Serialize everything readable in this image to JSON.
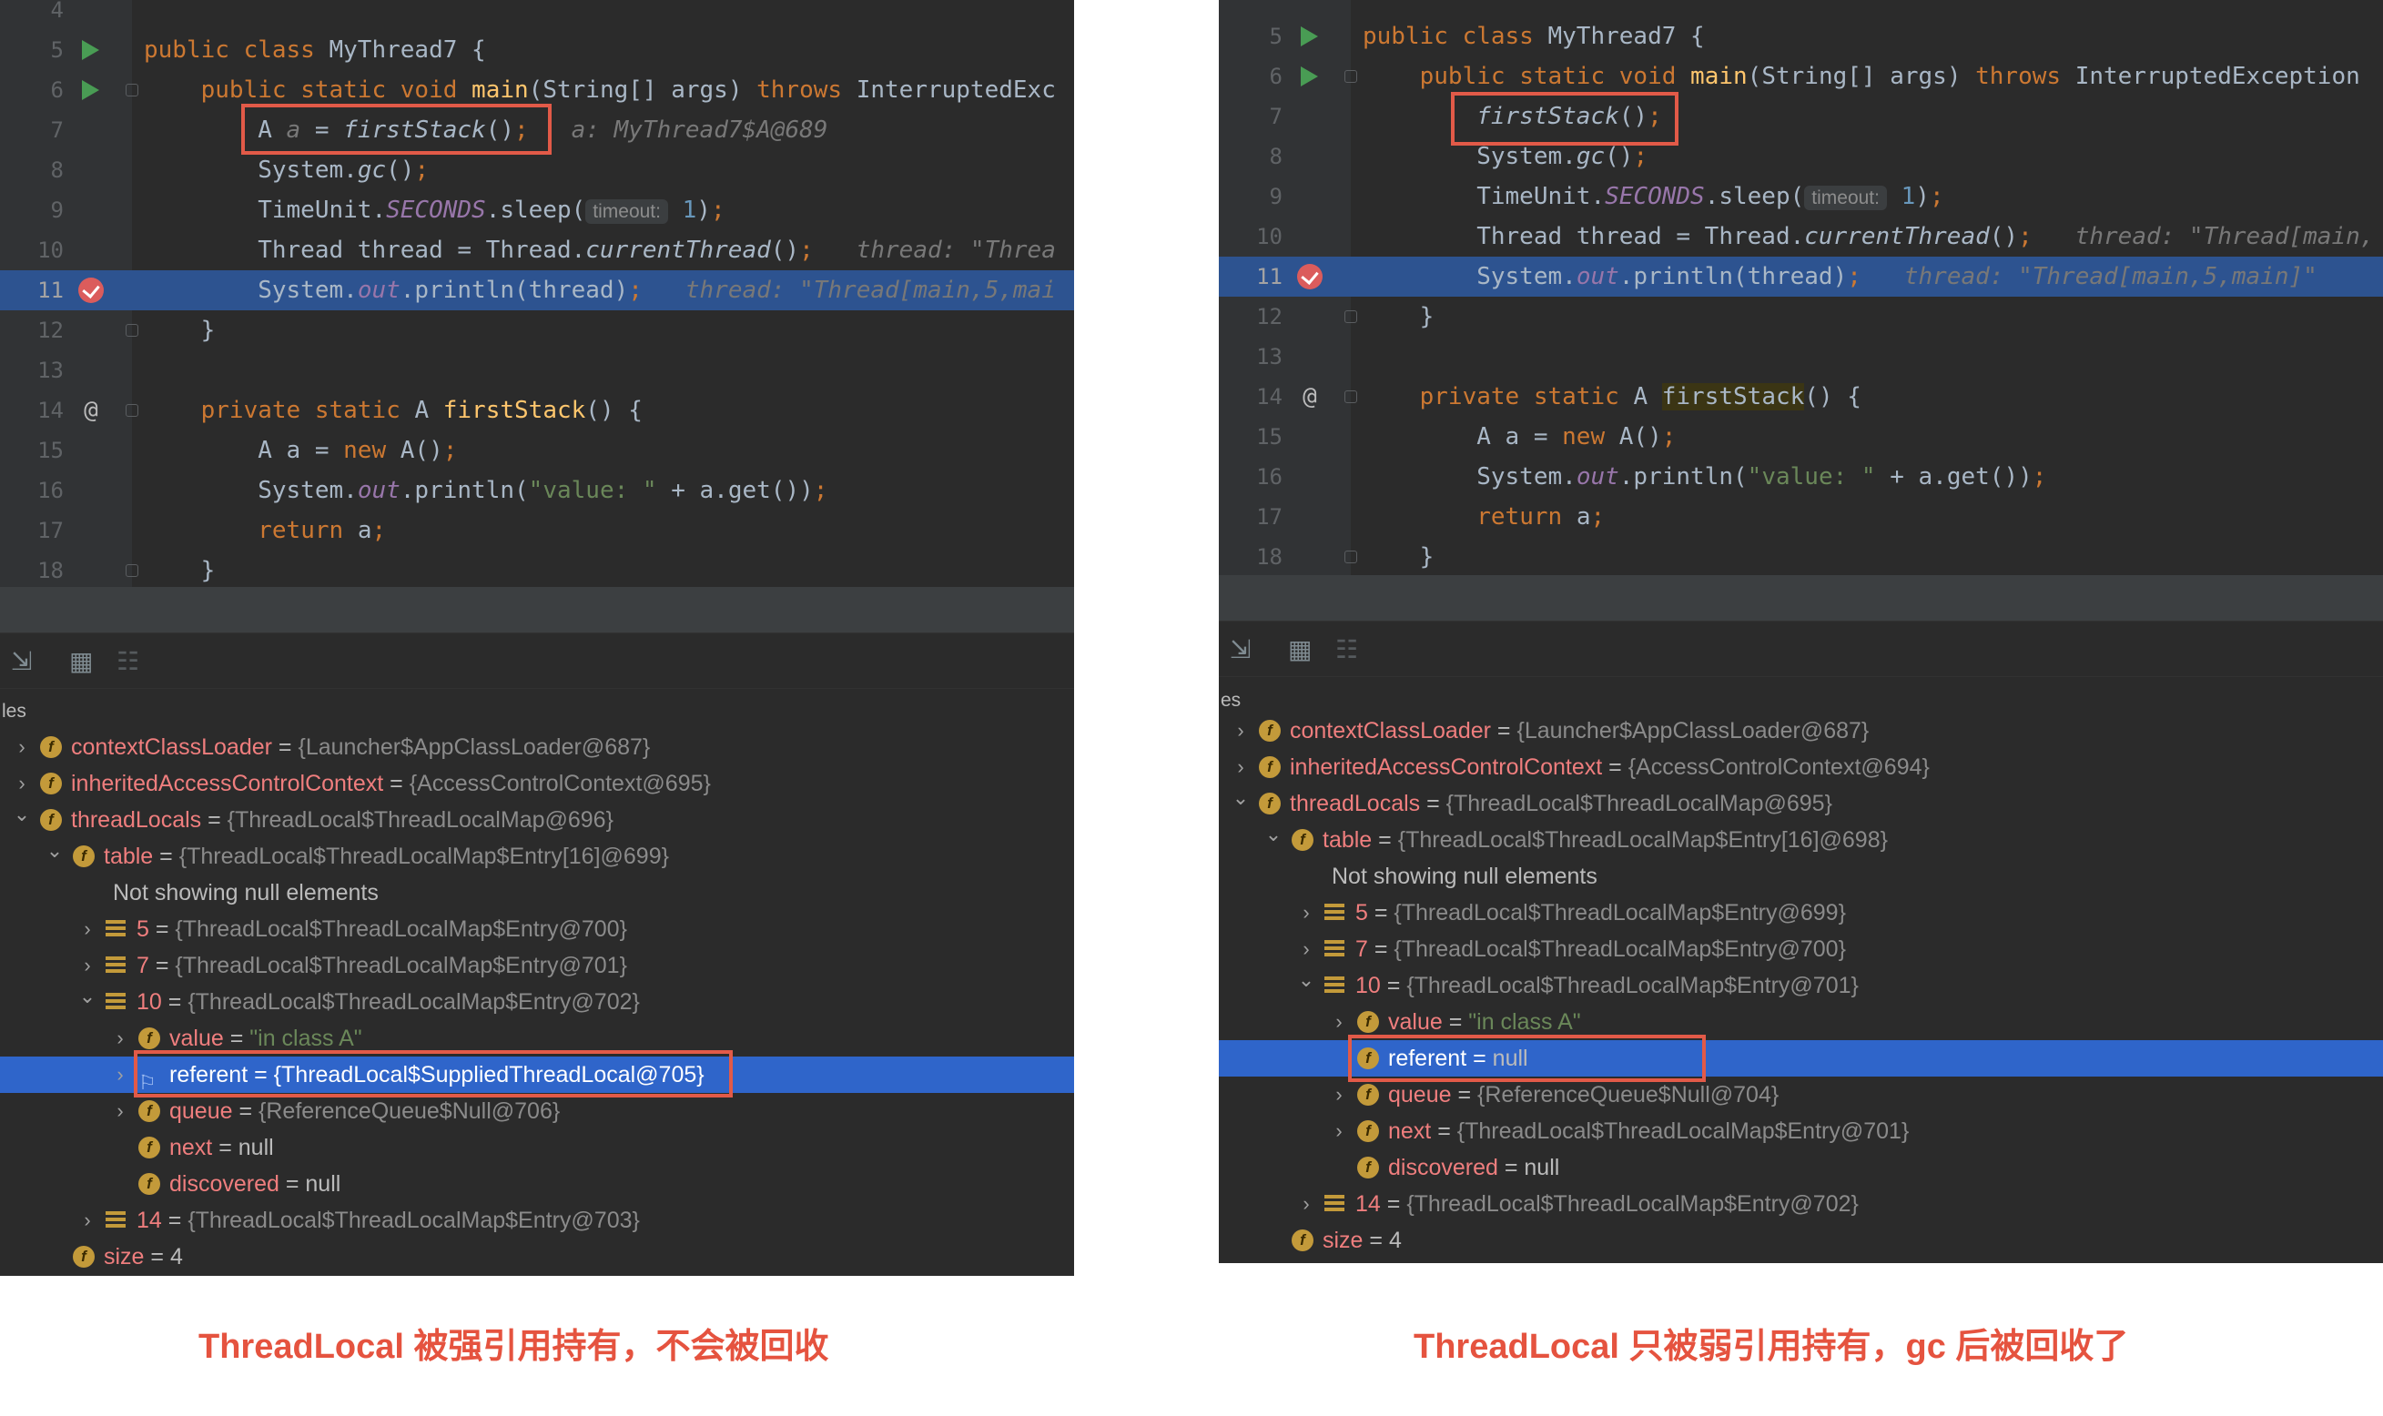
{
  "left": {
    "code_lines": [
      {
        "n": "4"
      },
      {
        "n": "5",
        "run": true,
        "t": [
          [
            "kw",
            "public class "
          ],
          [
            "",
            "MyThread7 {"
          ]
        ]
      },
      {
        "n": "6",
        "run": true,
        "fold": true,
        "t": [
          [
            "",
            "    "
          ],
          [
            "kw",
            "public static void "
          ],
          [
            "fn",
            "main"
          ],
          [
            "",
            "(String[] args) "
          ],
          [
            "kw",
            "throws "
          ],
          [
            "",
            "InterruptedExc"
          ]
        ]
      },
      {
        "n": "7",
        "t": [
          [
            "",
            "        A "
          ],
          [
            "hint",
            "a"
          ],
          [
            "",
            " = "
          ],
          [
            "it",
            "firstStack"
          ],
          [
            "",
            "()"
          ],
          [
            "kw",
            ";"
          ],
          [
            "",
            "   "
          ],
          [
            "hint",
            "a: MyThread7$A@689"
          ]
        ]
      },
      {
        "n": "8",
        "t": [
          [
            "",
            "        System."
          ],
          [
            "it",
            "gc"
          ],
          [
            "",
            "()"
          ],
          [
            "kw",
            ";"
          ]
        ]
      },
      {
        "n": "9",
        "t": [
          [
            "",
            "        TimeUnit."
          ],
          [
            "field",
            "SECONDS"
          ],
          [
            "",
            ".sleep("
          ],
          [
            "pill",
            "timeout:"
          ],
          [
            "num",
            " 1"
          ],
          [
            "",
            ")"
          ],
          [
            "kw",
            ";"
          ]
        ]
      },
      {
        "n": "10",
        "t": [
          [
            "",
            "        Thread thread = Thread."
          ],
          [
            "it",
            "currentThread"
          ],
          [
            "",
            "()"
          ],
          [
            "kw",
            ";"
          ],
          [
            "",
            "   "
          ],
          [
            "hint",
            "thread: \"Threa"
          ]
        ]
      },
      {
        "n": "11",
        "bp": true,
        "hl": true,
        "t": [
          [
            "",
            "        System."
          ],
          [
            "field",
            "out"
          ],
          [
            "",
            ".println(thread)"
          ],
          [
            "kw",
            ";"
          ],
          [
            "",
            "   "
          ],
          [
            "hint",
            "thread: \"Thread[main,5,mai"
          ]
        ]
      },
      {
        "n": "12",
        "fold": true,
        "t": [
          [
            "",
            "    }"
          ]
        ]
      },
      {
        "n": "13"
      },
      {
        "n": "14",
        "at": true,
        "fold": true,
        "t": [
          [
            "",
            "    "
          ],
          [
            "kw",
            "private static "
          ],
          [
            "",
            "A "
          ],
          [
            "fn",
            "firstStack"
          ],
          [
            "",
            "() {"
          ]
        ]
      },
      {
        "n": "15",
        "t": [
          [
            "",
            "        A a = "
          ],
          [
            "kw",
            "new "
          ],
          [
            "",
            "A()"
          ],
          [
            "kw",
            ";"
          ]
        ]
      },
      {
        "n": "16",
        "t": [
          [
            "",
            "        System."
          ],
          [
            "field",
            "out"
          ],
          [
            "",
            ".println("
          ],
          [
            "str",
            "\"value: \""
          ],
          [
            "",
            " + a.get())"
          ],
          [
            "kw",
            ";"
          ]
        ]
      },
      {
        "n": "17",
        "t": [
          [
            "",
            "        "
          ],
          [
            "kw",
            "return "
          ],
          [
            "",
            "a"
          ],
          [
            "kw",
            ";"
          ]
        ]
      },
      {
        "n": "18",
        "fold": true,
        "t": [
          [
            "",
            "    }"
          ]
        ]
      }
    ],
    "vars_label": "les",
    "tree": [
      {
        "lvl": 0,
        "arrow": "right",
        "icon": "f",
        "name": "contextClassLoader",
        "val": "{Launcher$AppClassLoader@687}"
      },
      {
        "lvl": 0,
        "arrow": "right",
        "icon": "f",
        "name": "inheritedAccessControlContext",
        "val": "{AccessControlContext@695}"
      },
      {
        "lvl": 0,
        "arrow": "down",
        "icon": "f",
        "name": "threadLocals",
        "val": "{ThreadLocal$ThreadLocalMap@696}"
      },
      {
        "lvl": 1,
        "arrow": "down",
        "icon": "f",
        "name": "table",
        "val": "{ThreadLocal$ThreadLocalMap$Entry[16]@699}"
      },
      {
        "lvl": 2,
        "plain": "Not showing null elements"
      },
      {
        "lvl": 2,
        "arrow": "right",
        "icon": "a",
        "name": "5",
        "val": "{ThreadLocal$ThreadLocalMap$Entry@700}"
      },
      {
        "lvl": 2,
        "arrow": "right",
        "icon": "a",
        "name": "7",
        "val": "{ThreadLocal$ThreadLocalMap$Entry@701}"
      },
      {
        "lvl": 2,
        "arrow": "down",
        "icon": "a",
        "name": "10",
        "val": "{ThreadLocal$ThreadLocalMap$Entry@702}"
      },
      {
        "lvl": 3,
        "arrow": "right",
        "icon": "f",
        "name": "value",
        "str": "\"in class A\""
      },
      {
        "lvl": 3,
        "arrow": "right",
        "icon": "flag",
        "name": "referent",
        "val": "{ThreadLocal$SuppliedThreadLocal@705}",
        "sel": true
      },
      {
        "lvl": 3,
        "arrow": "right",
        "icon": "f",
        "name": "queue",
        "val": "{ReferenceQueue$Null@706}"
      },
      {
        "lvl": 3,
        "icon": "f",
        "name": "next",
        "null": "null"
      },
      {
        "lvl": 3,
        "icon": "f",
        "name": "discovered",
        "null": "null"
      },
      {
        "lvl": 2,
        "arrow": "right",
        "icon": "a",
        "name": "14",
        "val": "{ThreadLocal$ThreadLocalMap$Entry@703}"
      },
      {
        "lvl": 1,
        "icon": "f",
        "name": "size",
        "null": "4"
      }
    ],
    "caption": "ThreadLocal 被强引用持有，不会被回收"
  },
  "right": {
    "code_lines": [
      {
        "n": "5",
        "run": true,
        "t": [
          [
            "kw",
            "public class "
          ],
          [
            "",
            "MyThread7 {"
          ]
        ]
      },
      {
        "n": "6",
        "run": true,
        "fold": true,
        "t": [
          [
            "",
            "    "
          ],
          [
            "kw",
            "public static void "
          ],
          [
            "fn",
            "main"
          ],
          [
            "",
            "(String[] args) "
          ],
          [
            "kw",
            "throws "
          ],
          [
            "",
            "InterruptedException"
          ]
        ]
      },
      {
        "n": "7",
        "t": [
          [
            "",
            "        "
          ],
          [
            "it",
            "firstStack"
          ],
          [
            "",
            "()"
          ],
          [
            "kw",
            ";"
          ]
        ]
      },
      {
        "n": "8",
        "t": [
          [
            "",
            "        System."
          ],
          [
            "it",
            "gc"
          ],
          [
            "",
            "()"
          ],
          [
            "kw",
            ";"
          ]
        ]
      },
      {
        "n": "9",
        "t": [
          [
            "",
            "        TimeUnit."
          ],
          [
            "field",
            "SECONDS"
          ],
          [
            "",
            ".sleep("
          ],
          [
            "pill",
            "timeout:"
          ],
          [
            "num",
            " 1"
          ],
          [
            "",
            ")"
          ],
          [
            "kw",
            ";"
          ]
        ]
      },
      {
        "n": "10",
        "t": [
          [
            "",
            "        Thread thread = Thread."
          ],
          [
            "it",
            "currentThread"
          ],
          [
            "",
            "()"
          ],
          [
            "kw",
            ";"
          ],
          [
            "",
            "   "
          ],
          [
            "hint",
            "thread: \"Thread[main,"
          ]
        ]
      },
      {
        "n": "11",
        "bp": true,
        "hl": true,
        "t": [
          [
            "",
            "        System."
          ],
          [
            "field",
            "out"
          ],
          [
            "",
            ".println(thread)"
          ],
          [
            "kw",
            ";"
          ],
          [
            "",
            "   "
          ],
          [
            "hint",
            "thread: \"Thread[main,5,main]\""
          ]
        ]
      },
      {
        "n": "12",
        "fold": true,
        "t": [
          [
            "",
            "    }"
          ]
        ]
      },
      {
        "n": "13"
      },
      {
        "n": "14",
        "at": true,
        "fold": true,
        "t": [
          [
            "",
            "    "
          ],
          [
            "kw",
            "private static "
          ],
          [
            "",
            "A "
          ],
          [
            "match",
            "firstStack"
          ],
          [
            "",
            "() {"
          ]
        ]
      },
      {
        "n": "15",
        "t": [
          [
            "",
            "        A a = "
          ],
          [
            "kw",
            "new "
          ],
          [
            "",
            "A()"
          ],
          [
            "kw",
            ";"
          ]
        ]
      },
      {
        "n": "16",
        "t": [
          [
            "",
            "        System."
          ],
          [
            "field",
            "out"
          ],
          [
            "",
            ".println("
          ],
          [
            "str",
            "\"value: \""
          ],
          [
            "",
            " + a.get())"
          ],
          [
            "kw",
            ";"
          ]
        ]
      },
      {
        "n": "17",
        "t": [
          [
            "",
            "        "
          ],
          [
            "kw",
            "return "
          ],
          [
            "",
            "a"
          ],
          [
            "kw",
            ";"
          ]
        ]
      },
      {
        "n": "18",
        "fold": true,
        "t": [
          [
            "",
            "    }"
          ]
        ]
      }
    ],
    "vars_label": "es",
    "tree": [
      {
        "lvl": 0,
        "arrow": "right",
        "icon": "f",
        "name": "contextClassLoader",
        "val": "{Launcher$AppClassLoader@687}"
      },
      {
        "lvl": 0,
        "arrow": "right",
        "icon": "f",
        "name": "inheritedAccessControlContext",
        "val": "{AccessControlContext@694}"
      },
      {
        "lvl": 0,
        "arrow": "down",
        "icon": "f",
        "name": "threadLocals",
        "val": "{ThreadLocal$ThreadLocalMap@695}"
      },
      {
        "lvl": 1,
        "arrow": "down",
        "icon": "f",
        "name": "table",
        "val": "{ThreadLocal$ThreadLocalMap$Entry[16]@698}"
      },
      {
        "lvl": 2,
        "plain": "Not showing null elements"
      },
      {
        "lvl": 2,
        "arrow": "right",
        "icon": "a",
        "name": "5",
        "val": "{ThreadLocal$ThreadLocalMap$Entry@699}"
      },
      {
        "lvl": 2,
        "arrow": "right",
        "icon": "a",
        "name": "7",
        "val": "{ThreadLocal$ThreadLocalMap$Entry@700}"
      },
      {
        "lvl": 2,
        "arrow": "down",
        "icon": "a",
        "name": "10",
        "val": "{ThreadLocal$ThreadLocalMap$Entry@701}"
      },
      {
        "lvl": 3,
        "arrow": "right",
        "icon": "f",
        "name": "value",
        "str": "\"in class A\""
      },
      {
        "lvl": 3,
        "icon": "f",
        "name": "referent",
        "null": "null",
        "sel": true
      },
      {
        "lvl": 3,
        "arrow": "right",
        "icon": "f",
        "name": "queue",
        "val": "{ReferenceQueue$Null@704}"
      },
      {
        "lvl": 3,
        "arrow": "right",
        "icon": "f",
        "name": "next",
        "val": "{ThreadLocal$ThreadLocalMap$Entry@701}"
      },
      {
        "lvl": 3,
        "icon": "f",
        "name": "discovered",
        "null": "null"
      },
      {
        "lvl": 2,
        "arrow": "right",
        "icon": "a",
        "name": "14",
        "val": "{ThreadLocal$ThreadLocalMap$Entry@702}"
      },
      {
        "lvl": 1,
        "icon": "f",
        "name": "size",
        "null": "4"
      }
    ],
    "caption": "ThreadLocal 只被弱引用持有，gc 后被回收了"
  },
  "colors": {
    "accent_red": "#e25a48",
    "selection": "#2f65ca",
    "highlight_line": "#2d5390"
  },
  "icons": [
    "run-icon",
    "breakpoint-icon",
    "override-icon",
    "fold-icon",
    "field-icon",
    "array-icon",
    "referent-flag-icon",
    "restore-layout-icon",
    "table-view-icon",
    "settings-icon"
  ]
}
